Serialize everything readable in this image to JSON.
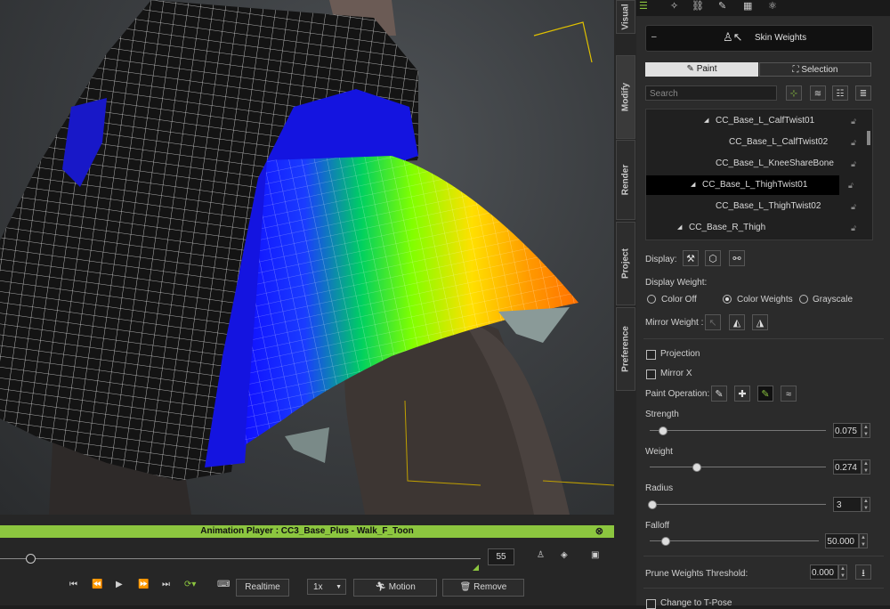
{
  "animation_player": {
    "title": "Animation Player : CC3_Base_Plus - Walk_F_Toon",
    "frame": "55",
    "realtime_label": "Realtime",
    "speed": "1x",
    "motion_label": "Motion",
    "remove_label": "Remove",
    "progress": 0.06
  },
  "side_tabs": [
    "Visual",
    "Modify",
    "Render",
    "Project",
    "Preference"
  ],
  "panel": {
    "header_title": "Skin Weights",
    "collapse_symbol": "–",
    "tab_paint": "Paint",
    "tab_selection": "Selection",
    "search_placeholder": "Search",
    "bones": [
      {
        "name": "CC_Base_L_CalfTwist01",
        "expander": "◢"
      },
      {
        "name": "CC_Base_L_CalfTwist02",
        "expander": ""
      },
      {
        "name": "CC_Base_L_KneeShareBone",
        "expander": ""
      },
      {
        "name": "CC_Base_L_ThighTwist01",
        "expander": "◢",
        "selected": true
      },
      {
        "name": "CC_Base_L_ThighTwist02",
        "expander": ""
      },
      {
        "name": "CC_Base_R_Thigh",
        "expander": "◢"
      }
    ],
    "display_label": "Display:",
    "display_weight_label": "Display Weight:",
    "color_off": "Color Off",
    "color_weights": "Color Weights",
    "grayscale": "Grayscale",
    "mirror_weight_label": "Mirror Weight :",
    "projection_label": "Projection",
    "mirror_x_label": "Mirror X",
    "paint_operation_label": "Paint Operation:",
    "strength_label": "Strength",
    "strength_value": "0.075",
    "weight_label": "Weight",
    "weight_value": "0.274",
    "radius_label": "Radius",
    "radius_value": "3",
    "falloff_label": "Falloff",
    "falloff_value": "50.000",
    "prune_label": "Prune Weights Threshold:",
    "prune_value": "0.000",
    "t_pose_label": "Change to T-Pose"
  },
  "colors": {
    "accent": "#8cc63f",
    "panel_bg": "#2b2b2b",
    "selected_row": "#000000"
  }
}
